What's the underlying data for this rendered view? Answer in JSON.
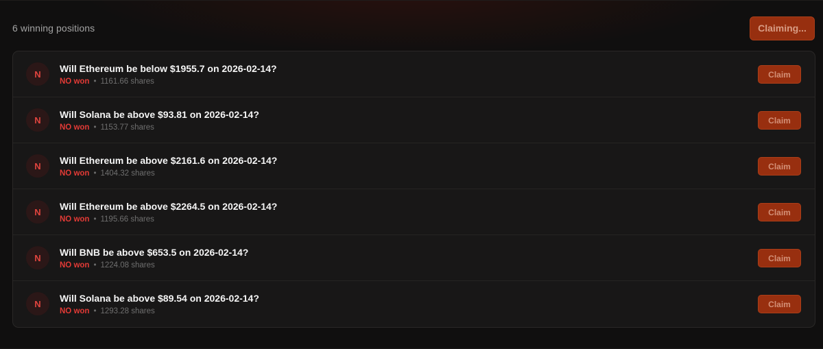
{
  "header": {
    "count_label": "6 winning positions",
    "claim_all_label": "Claiming..."
  },
  "positions": [
    {
      "avatar": "N",
      "question": "Will Ethereum be below $1955.7 on 2026-02-14?",
      "outcome": "NO won",
      "separator": "•",
      "shares": "1161.66 shares",
      "claim_label": "Claim"
    },
    {
      "avatar": "N",
      "question": "Will Solana be above $93.81 on 2026-02-14?",
      "outcome": "NO won",
      "separator": "•",
      "shares": "1153.77 shares",
      "claim_label": "Claim"
    },
    {
      "avatar": "N",
      "question": "Will Ethereum be above $2161.6 on 2026-02-14?",
      "outcome": "NO won",
      "separator": "•",
      "shares": "1404.32 shares",
      "claim_label": "Claim"
    },
    {
      "avatar": "N",
      "question": "Will Ethereum be above $2264.5 on 2026-02-14?",
      "outcome": "NO won",
      "separator": "•",
      "shares": "1195.66 shares",
      "claim_label": "Claim"
    },
    {
      "avatar": "N",
      "question": "Will BNB be above $653.5 on 2026-02-14?",
      "outcome": "NO won",
      "separator": "•",
      "shares": "1224.08 shares",
      "claim_label": "Claim"
    },
    {
      "avatar": "N",
      "question": "Will Solana be above $89.54 on 2026-02-14?",
      "outcome": "NO won",
      "separator": "•",
      "shares": "1293.28 shares",
      "claim_label": "Claim"
    }
  ],
  "colors": {
    "accent": "#a3320f",
    "no_won": "#e23a36",
    "background": "#100f0f",
    "panel": "#181717"
  }
}
